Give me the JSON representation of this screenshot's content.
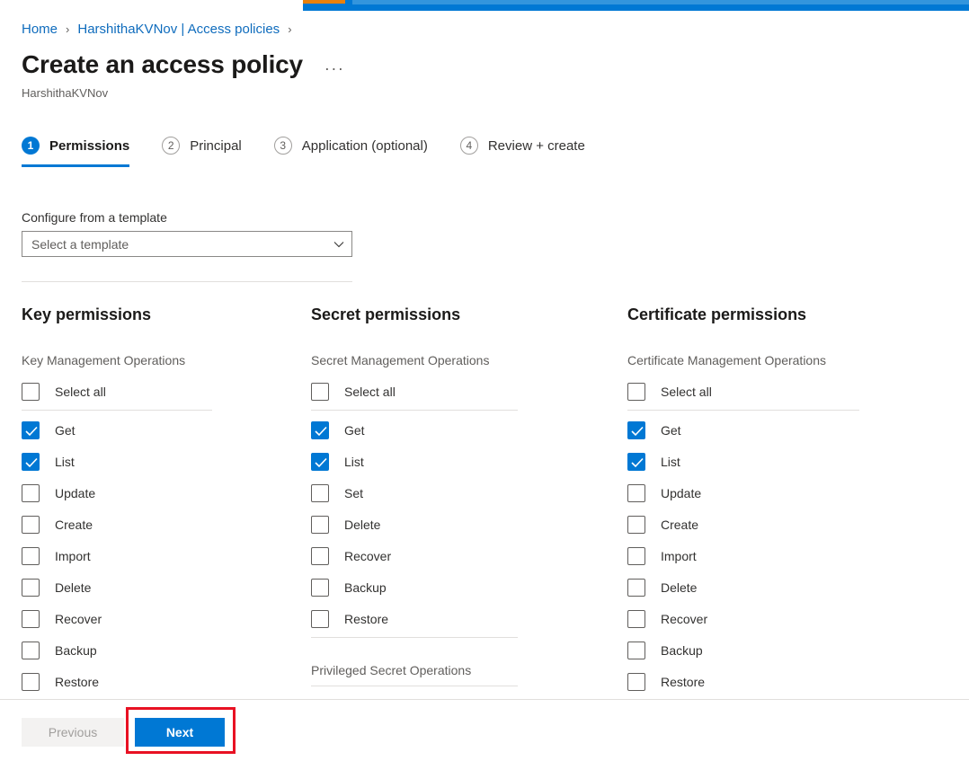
{
  "colors": {
    "accent": "#0078d4",
    "link": "#0f6cbd",
    "highlight": "#e81123",
    "tab_accent": "#e8810c",
    "divider": "#e1dfdd"
  },
  "breadcrumb": {
    "items": [
      {
        "label": "Home"
      },
      {
        "label": "HarshithaKVNov | Access policies"
      }
    ],
    "separator": "›"
  },
  "header": {
    "title": "Create an access policy",
    "more_label": "···",
    "subtitle": "HarshithaKVNov"
  },
  "steps": [
    {
      "number": "1",
      "label": "Permissions",
      "active": true
    },
    {
      "number": "2",
      "label": "Principal",
      "active": false
    },
    {
      "number": "3",
      "label": "Application (optional)",
      "active": false
    },
    {
      "number": "4",
      "label": "Review + create",
      "active": false
    }
  ],
  "template": {
    "label": "Configure from a template",
    "value": "Select a template",
    "placeholder": "Select a template"
  },
  "columns": [
    {
      "heading": "Key permissions",
      "groups": [
        {
          "label": "Key Management Operations",
          "select_all": {
            "label": "Select all",
            "checked": false
          },
          "items": [
            {
              "label": "Get",
              "checked": true
            },
            {
              "label": "List",
              "checked": true
            },
            {
              "label": "Update",
              "checked": false
            },
            {
              "label": "Create",
              "checked": false
            },
            {
              "label": "Import",
              "checked": false
            },
            {
              "label": "Delete",
              "checked": false
            },
            {
              "label": "Recover",
              "checked": false
            },
            {
              "label": "Backup",
              "checked": false
            },
            {
              "label": "Restore",
              "checked": false
            }
          ]
        }
      ]
    },
    {
      "heading": "Secret permissions",
      "groups": [
        {
          "label": "Secret Management Operations",
          "select_all": {
            "label": "Select all",
            "checked": false
          },
          "items": [
            {
              "label": "Get",
              "checked": true
            },
            {
              "label": "List",
              "checked": true
            },
            {
              "label": "Set",
              "checked": false
            },
            {
              "label": "Delete",
              "checked": false
            },
            {
              "label": "Recover",
              "checked": false
            },
            {
              "label": "Backup",
              "checked": false
            },
            {
              "label": "Restore",
              "checked": false
            }
          ]
        },
        {
          "label": "Privileged Secret Operations",
          "select_all": null,
          "items": []
        }
      ]
    },
    {
      "heading": "Certificate permissions",
      "groups": [
        {
          "label": "Certificate Management Operations",
          "select_all": {
            "label": "Select all",
            "checked": false
          },
          "items": [
            {
              "label": "Get",
              "checked": true
            },
            {
              "label": "List",
              "checked": true
            },
            {
              "label": "Update",
              "checked": false
            },
            {
              "label": "Create",
              "checked": false
            },
            {
              "label": "Import",
              "checked": false
            },
            {
              "label": "Delete",
              "checked": false
            },
            {
              "label": "Recover",
              "checked": false
            },
            {
              "label": "Backup",
              "checked": false
            },
            {
              "label": "Restore",
              "checked": false
            }
          ]
        }
      ]
    }
  ],
  "footer": {
    "previous_label": "Previous",
    "next_label": "Next"
  }
}
